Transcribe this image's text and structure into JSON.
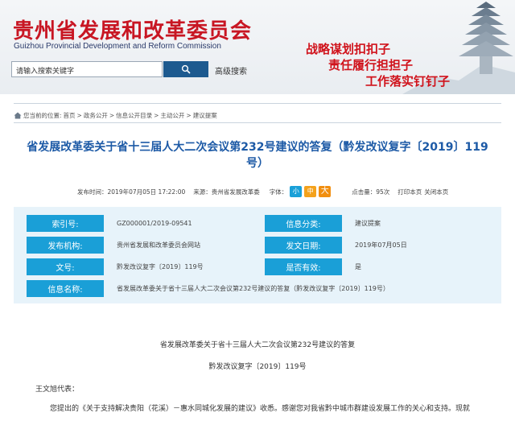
{
  "header": {
    "org_name_cn": "贵州省发展和改革委员会",
    "org_name_en": "Guizhou Provincial Development and Reform Commission",
    "search_placeholder": "请输入搜索关键字",
    "advanced_search": "高级搜索",
    "slogan": [
      "战略谋划扣扣子",
      "责任履行担担子",
      "工作落实钉钉子"
    ],
    "accent": "#c81623"
  },
  "breadcrumb": {
    "prefix": "您当前的位置:",
    "items": [
      "首页",
      "政务公开",
      "信息公开目录",
      "主动公开",
      "建议提案"
    ],
    "sep": ">"
  },
  "article": {
    "title": "省发展改革委关于省十三届人大二次会议第232号建议的答复（黔发改议复字〔2019〕119号）",
    "meta": {
      "publish_label": "发布时间：",
      "publish_time": "2019年07月05日 17:22:00",
      "source_label": "来源：",
      "source": "贵州省发展改革委",
      "font_label": "字体：",
      "font_small": "小",
      "font_mid": "中",
      "font_big": "大",
      "views_label": "点击量：",
      "views": "95次",
      "print": "打印本页",
      "close": "关闭本页"
    }
  },
  "info": {
    "index_label": "索引号:",
    "index_value": "GZ000001/2019-09541",
    "category_label": "信息分类:",
    "category_value": "建议提案",
    "publisher_label": "发布机构:",
    "publisher_value": "贵州省发展和改革委员会网站",
    "date_label": "发文日期:",
    "date_value": "2019年07月05日",
    "docno_label": "文号:",
    "docno_value": "黔发改议复字〔2019〕119号",
    "valid_label": "是否有效:",
    "valid_value": "是",
    "name_label": "信息名称:",
    "name_value": "省发展改革委关于省十三届人大二次会议第232号建议的答复（黔发改议复字〔2019〕119号）"
  },
  "body": {
    "subtitle1": "省发展改革委关于省十三届人大二次会议第232号建议的答复",
    "subtitle2": "黔发改议复字〔2019〕119号",
    "salutation": "王文旭代表：",
    "para1": "您提出的《关于支持解决贵阳（花溪）－惠水同城化发展的建议》收悉。感谢您对我省黔中城市群建设发展工作的关心和支持。现就"
  }
}
